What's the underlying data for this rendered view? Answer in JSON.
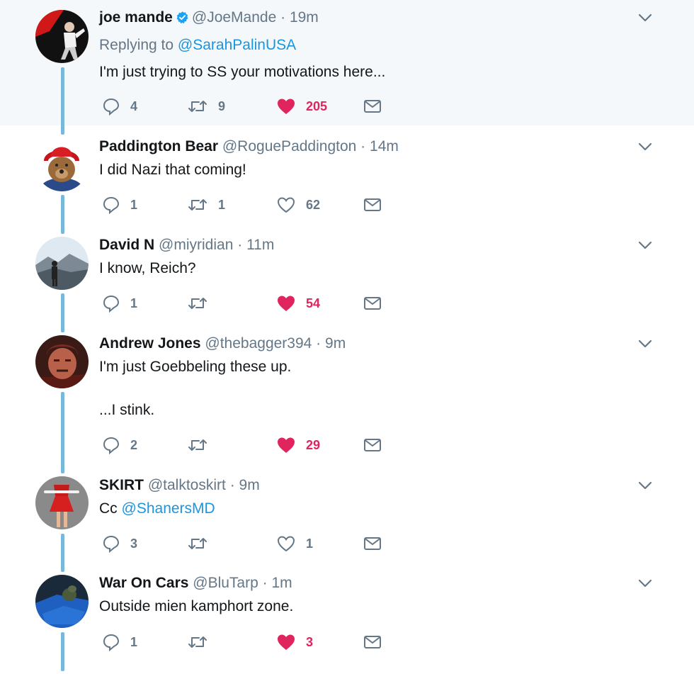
{
  "colors": {
    "accent": "#1b95e0",
    "like": "#e0245e",
    "muted": "#657786",
    "thread": "#79b8d9",
    "highlight": "#f5f8fa"
  },
  "tweets": [
    {
      "name": "joe mande",
      "verified": true,
      "handle": "@JoeMande",
      "time": "19m",
      "replying_prefix": "Replying to",
      "replying_to": "@SarahPalinUSA",
      "lines": [
        "I'm just trying to SS your motivations here..."
      ],
      "replies": "4",
      "retweets": "9",
      "likes": "205",
      "liked": true
    },
    {
      "name": "Paddington Bear",
      "handle": "@RoguePaddington",
      "time": "14m",
      "lines": [
        "I did Nazi that coming!"
      ],
      "replies": "1",
      "retweets": "1",
      "likes": "62",
      "liked": false
    },
    {
      "name": "David N",
      "handle": "@miyridian",
      "time": "11m",
      "lines": [
        "I know, Reich?"
      ],
      "replies": "1",
      "retweets": "",
      "likes": "54",
      "liked": true
    },
    {
      "name": "Andrew Jones",
      "handle": "@thebagger394",
      "time": "9m",
      "lines": [
        "I'm just Goebbeling these up.",
        "...I stink."
      ],
      "replies": "2",
      "retweets": "",
      "likes": "29",
      "liked": true
    },
    {
      "name": "SKIRT",
      "handle": "@talktoskirt",
      "time": "9m",
      "text_prefix": "Cc",
      "mention": "@ShanersMD",
      "replies": "3",
      "retweets": "",
      "likes": "1",
      "liked": false
    },
    {
      "name": "War On Cars",
      "handle": "@BluTarp",
      "time": "1m",
      "lines": [
        "Outside mien kamphort zone."
      ],
      "replies": "1",
      "retweets": "",
      "likes": "3",
      "liked": true
    }
  ],
  "separator": "·"
}
